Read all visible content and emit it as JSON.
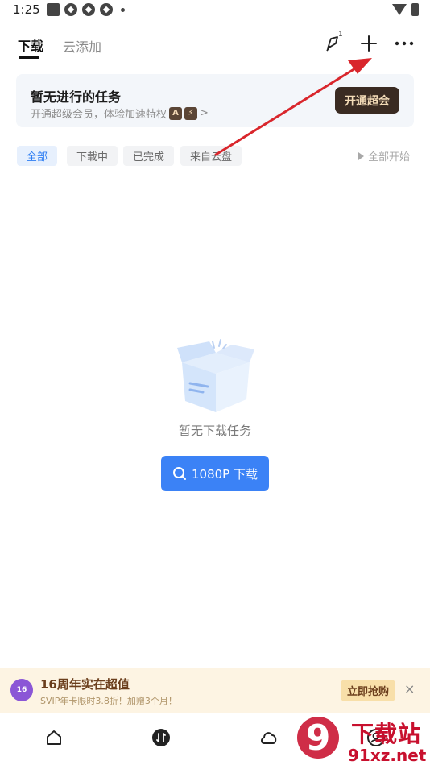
{
  "status_bar": {
    "time": "1:25"
  },
  "header": {
    "tabs": [
      {
        "label": "下载",
        "active": true
      },
      {
        "label": "云添加",
        "active": false
      }
    ],
    "icons": {
      "notify_count": "1"
    }
  },
  "vip_card": {
    "title": "暂无进行的任务",
    "subtitle": "开通超级会员，体验加速特权",
    "badge_a": "A",
    "badge_b": "⚡",
    "arrow": ">",
    "button": "开通超会"
  },
  "filters": {
    "chips": [
      {
        "label": "全部",
        "active": true
      },
      {
        "label": "下载中",
        "active": false
      },
      {
        "label": "已完成",
        "active": false
      },
      {
        "label": "来自云盘",
        "active": false
      }
    ],
    "start_all": "全部开始"
  },
  "empty": {
    "text": "暂无下载任务",
    "button": "1080P 下载"
  },
  "promo": {
    "badge": "16",
    "title": "16周年实在超值",
    "subtitle": "SVIP年卡限时3.8折！加赠3个月！",
    "button": "立即抢购",
    "close": "×"
  },
  "watermark": {
    "brand": "下载站",
    "url": "91xz.net",
    "number": "9"
  },
  "colors": {
    "accent": "#3b82f6",
    "vip_dark": "#3a2b22",
    "annotation": "#d9262c"
  }
}
